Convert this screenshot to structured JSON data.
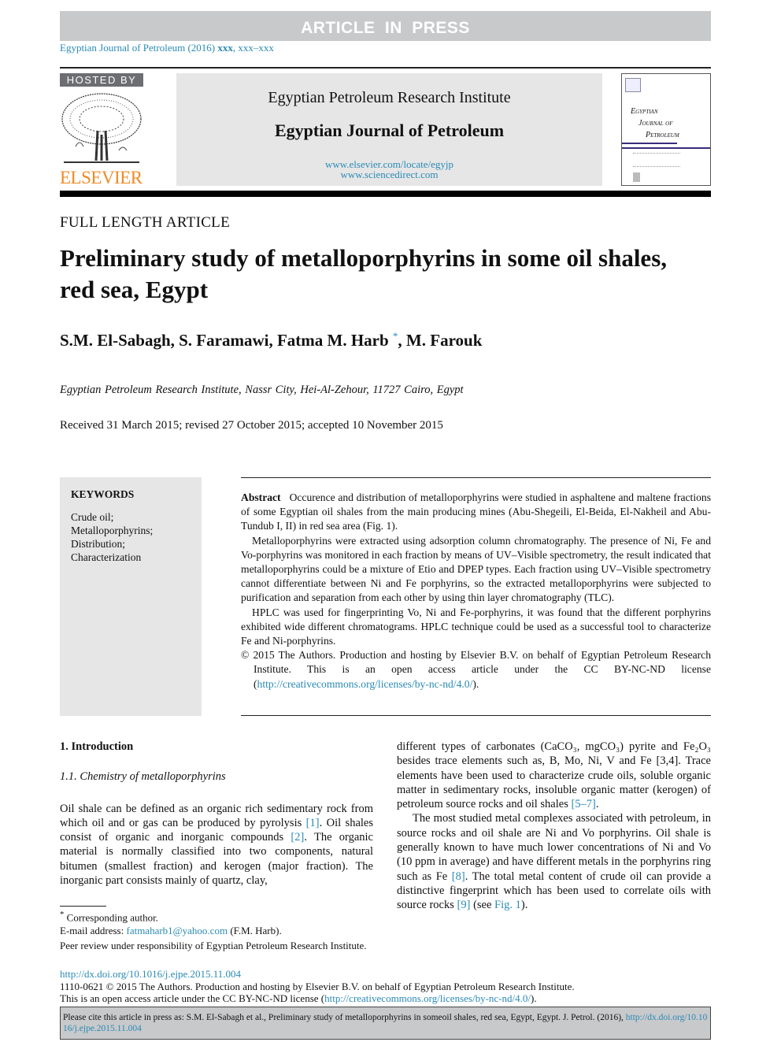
{
  "banner": {
    "article_in_press": "ARTICLE IN PRESS"
  },
  "citation_line": {
    "journal": "Egyptian Journal of Petroleum (2016)",
    "volume": "xxx",
    "pages": ", xxx–xxx"
  },
  "header": {
    "hosted_by": "HOSTED BY",
    "publisher_logo": "ELSEVIER",
    "institute": "Egyptian Petroleum Research Institute",
    "journal": "Egyptian Journal of Petroleum",
    "url1": "www.elsevier.com/locate/egyjp",
    "url2": "www.sciencedirect.com",
    "cover": {
      "line1": "Egyptian",
      "line2": "Journal of",
      "line3": "Petroleum"
    }
  },
  "article": {
    "type": "FULL LENGTH ARTICLE",
    "title": "Preliminary study of metalloporphyrins in some oil shales, red sea, Egypt",
    "authors_pre": "S.M. El-Sabagh, S. Faramawi, Fatma M. Harb",
    "author_mark": "*",
    "authors_post": ", M. Farouk",
    "affiliation": "Egyptian Petroleum Research Institute, Nassr City, Hei-Al-Zehour, 11727 Cairo, Egypt",
    "dates": "Received 31 March 2015; revised 27 October 2015; accepted 10 November 2015"
  },
  "keywords": {
    "heading": "KEYWORDS",
    "items": [
      "Crude oil;",
      "Metalloporphyrins;",
      "Distribution;",
      "Characterization"
    ]
  },
  "abstract": {
    "label": "Abstract",
    "p1": "Occurence and distribution of metalloporphyrins were studied in asphaltene and maltene fractions of some Egyptian oil shales from the main producing mines (Abu-Shegeili, El-Beida, El-Nakheil and Abu-Tundub I, II) in red sea area (Fig. 1).",
    "p2": "Metalloporphyrins were extracted using adsorption column chromatography. The presence of Ni, Fe and Vo-porphyrins was monitored in each fraction by means of UV–Visible spectrometry, the result indicated that metalloporphyrins could be a mixture of Etio and DPEP types. Each fraction using UV–Visible spectrometry cannot differentiate between Ni and Fe porphyrins, so the extracted metalloporphyrins were subjected to purification and separation from each other by using thin layer chromatography (TLC).",
    "p3": "HPLC was used for fingerprinting Vo, Ni and Fe-porphyrins, it was found that the different porphyrins exhibited wide different chromatograms. HPLC technique could be used as a successful tool to characterize Fe and Ni-porphyrins.",
    "license": "© 2015 The Authors. Production and hosting by Elsevier B.V. on behalf of Egyptian Petroleum Research Institute. This is an open access article under the CC BY-NC-ND license (",
    "license_url": "http://creativecommons.org/licenses/by-nc-nd/4.0/",
    "license_end": ")."
  },
  "body": {
    "section1": "1. Introduction",
    "subsection": "1.1. Chemistry of metalloporphyrins",
    "left_p1a": "Oil shale can be defined as an organic rich sedimentary rock from which oil and or gas can be produced by pyrolysis ",
    "ref1": "[1]",
    "left_p1b": ". Oil shales consist of organic and inorganic compounds ",
    "ref2": "[2]",
    "left_p1c": ". The organic material is normally classified into two components, natural bitumen (smallest fraction) and kerogen (major fraction). The inorganic part consists mainly of quartz, clay,",
    "right_p1a": "different types of carbonates (CaCO₃, mgCO₃) pyrite and Fe₂O₃ besides trace elements such as, B, Mo, Ni, V and Fe [3,4]. Trace elements have been used to characterize crude oils, soluble organic matter in sedimentary rocks, insoluble organic matter (kerogen) of petroleum source rocks and oil shales ",
    "ref57": "[5–7]",
    "right_p1b": ".",
    "right_p2a": "The most studied metal complexes associated with petroleum, in source rocks and oil shale are Ni and Vo porphyrins. Oil shale is generally known to have much lower concentrations of Ni and Vo (10 ppm in average) and have different metals in the porphyrins ring such as Fe ",
    "ref8": "[8]",
    "right_p2b": ". The total metal content of crude oil can provide a distinctive fingerprint which has been used to correlate oils with source rocks ",
    "ref9": "[9]",
    "right_p2c": " (see ",
    "fig1": "Fig. 1",
    "right_p2d": ")."
  },
  "footnotes": {
    "mark": "*",
    "corresponding": " Corresponding author.",
    "email_label": "E-mail address: ",
    "email": "fatmaharb1@yahoo.com",
    "email_suffix": " (F.M. Harb).",
    "peer_review": "Peer review under responsibility of Egyptian Petroleum Research Institute."
  },
  "doi": {
    "url": "http://dx.doi.org/10.1016/j.ejpe.2015.11.004",
    "copyright": "1110-0621 © 2015 The Authors. Production and hosting by Elsevier B.V. on behalf of Egyptian Petroleum Research Institute.",
    "license_pre": "This is an open access article under the CC BY-NC-ND license (",
    "license_url": "http://creativecommons.org/licenses/by-nc-nd/4.0/",
    "license_post": ")."
  },
  "cite_box": {
    "text": "Please cite this article in press as: S.M. El-Sabagh et al., Preliminary study of metalloporphyrins in someoil shales, red sea, Egypt,  Egypt. J. Petrol. (2016), ",
    "url": "http://dx.doi.org/10.1016/j.ejpe.2015.11.004"
  },
  "colors": {
    "link": "#2a8ab5",
    "elsevier_orange": "#f08a24",
    "banner_gray": "#c8c9cb"
  }
}
